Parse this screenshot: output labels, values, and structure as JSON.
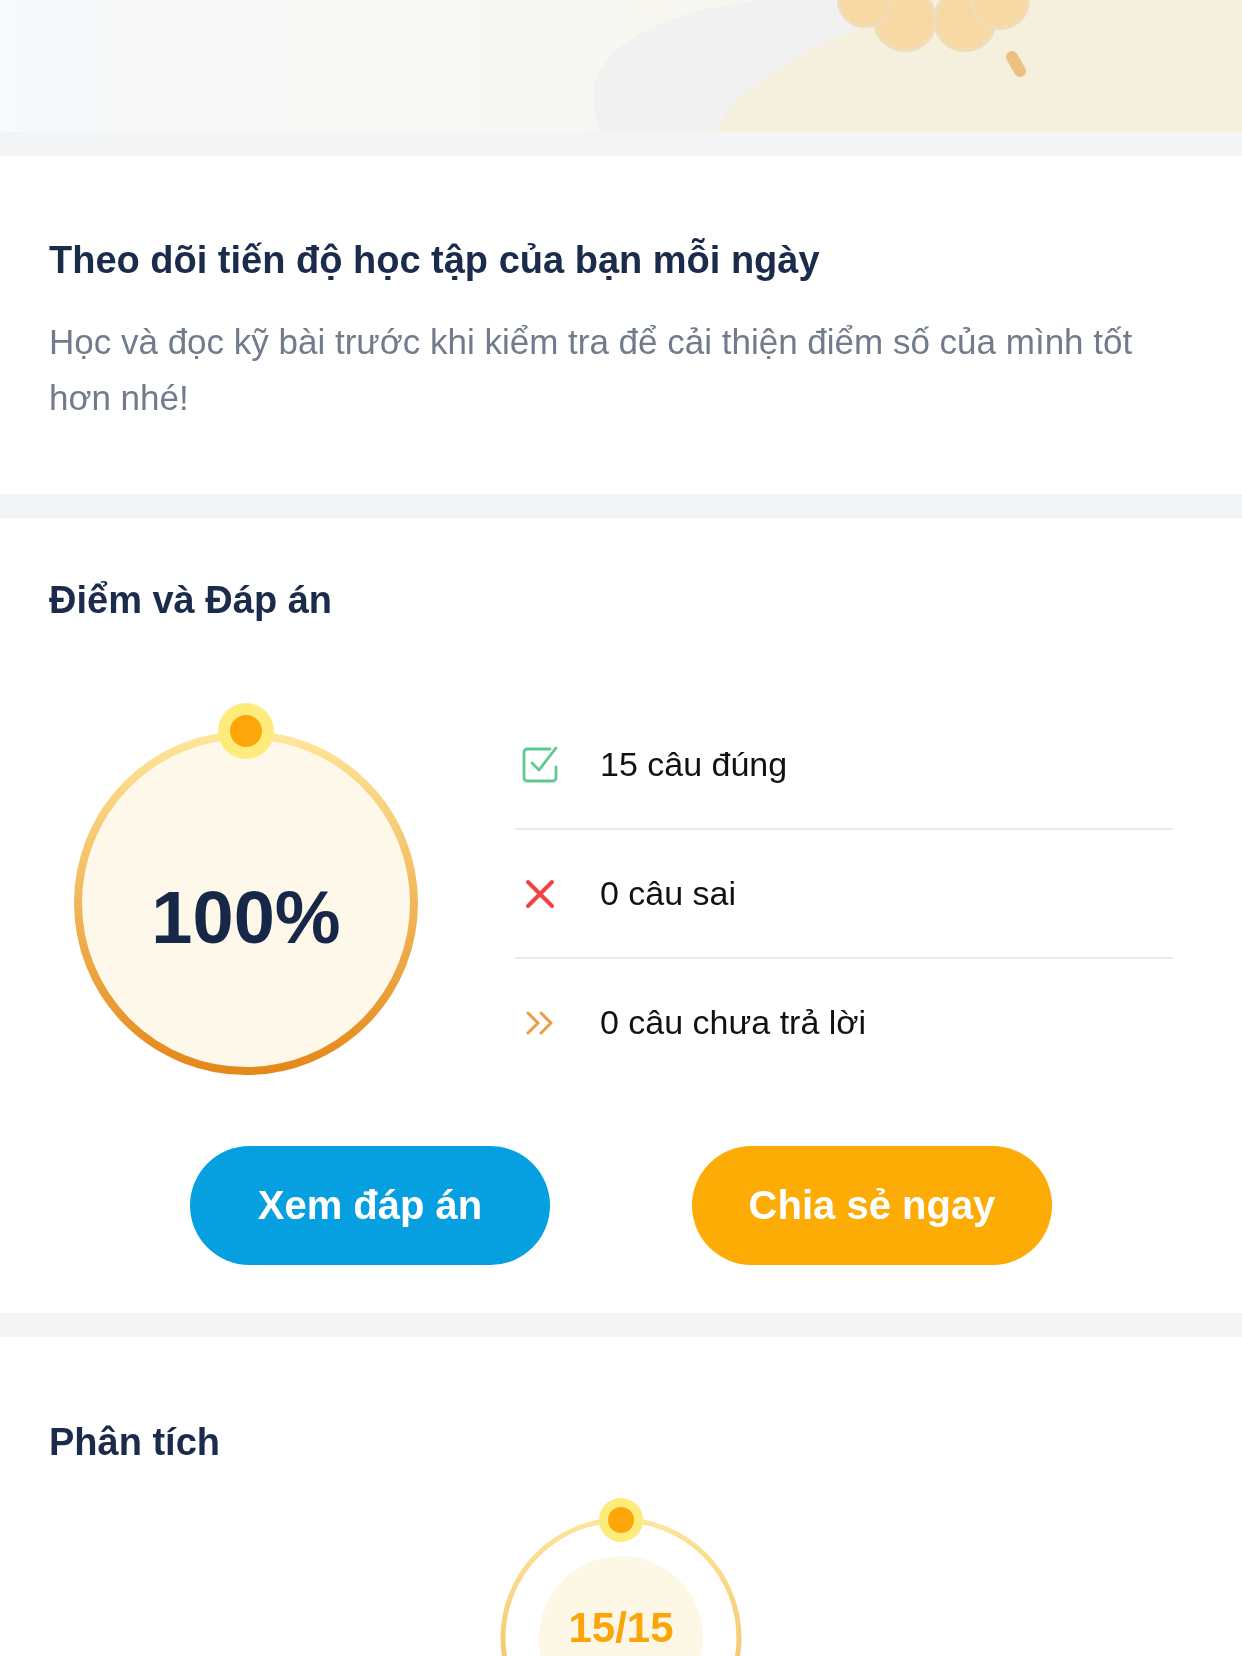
{
  "intro": {
    "title": "Theo dõi tiến độ học tập của bạn mỗi ngày",
    "description": "Học và đọc kỹ bài trước khi kiểm tra để cải thiện điểm số của mình tốt hơn nhé!"
  },
  "score": {
    "title": "Điểm và Đáp án",
    "percent": "100%",
    "stats": [
      {
        "kind": "correct",
        "label": "15 câu đúng"
      },
      {
        "kind": "wrong",
        "label": "0 câu sai"
      },
      {
        "kind": "skipped",
        "label": "0 câu chưa trả lời"
      }
    ],
    "buttons": [
      {
        "kind": "primary",
        "label": "Xem đáp án"
      },
      {
        "kind": "accent",
        "label": "Chia sẻ ngay"
      }
    ]
  },
  "analysis": {
    "title": "Phân tích",
    "score": "15/15"
  }
}
